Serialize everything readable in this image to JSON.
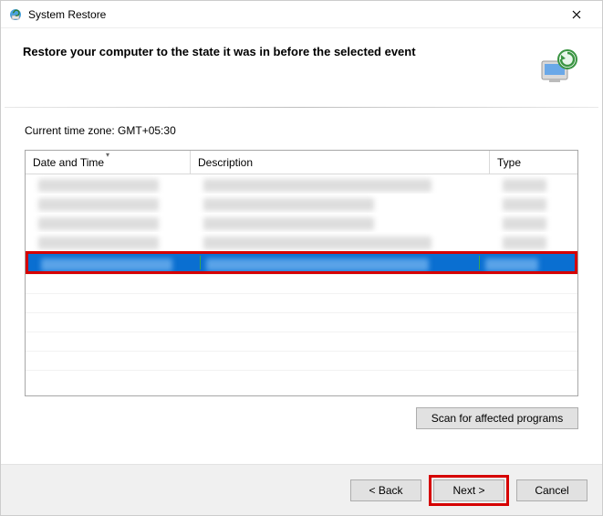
{
  "title": "System Restore",
  "header_text": "Restore your computer to the state it was in before the selected event",
  "timezone_label": "Current time zone: GMT+05:30",
  "columns": {
    "date_time": "Date and Time",
    "description": "Description",
    "type": "Type"
  },
  "scan_button": "Scan for affected programs",
  "footer": {
    "back": "< Back",
    "next": "Next >",
    "cancel": "Cancel"
  }
}
